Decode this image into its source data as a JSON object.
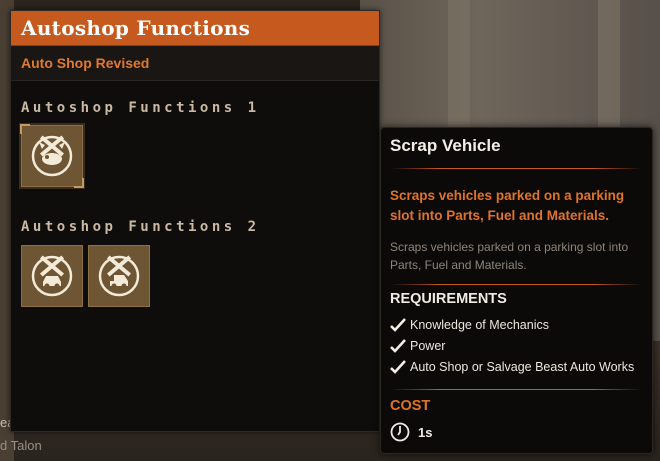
{
  "window": {
    "title": "Autoshop Functions",
    "subtitle": "Auto Shop Revised"
  },
  "sections": [
    {
      "title": "Autoshop Functions 1",
      "items": [
        {
          "icon": "wrench-hammer-meat-icon",
          "selected": true
        }
      ]
    },
    {
      "title": "Autoshop Functions 2",
      "items": [
        {
          "icon": "wrench-hammer-car-icon",
          "selected": false
        },
        {
          "icon": "wrench-hammer-jeep-icon",
          "selected": false
        }
      ]
    }
  ],
  "background_text": {
    "line1": "eacon",
    "line2": "d Talon"
  },
  "tooltip": {
    "title": "Scrap Vehicle",
    "description_accent": "Scraps vehicles parked on a parking slot into Parts, Fuel and Materials.",
    "description": "Scraps vehicles parked on a parking slot into Parts, Fuel and Materials.",
    "requirements_title": "REQUIREMENTS",
    "requirements": [
      "Knowledge of Mechanics",
      "Power",
      "Auto Shop or Salvage Beast Auto Works"
    ],
    "cost_title": "COST",
    "cost_value": "1s"
  },
  "colors": {
    "accent": "#c65a1e",
    "accent_text": "#e0732a",
    "slot_bg": "#6e5534"
  }
}
